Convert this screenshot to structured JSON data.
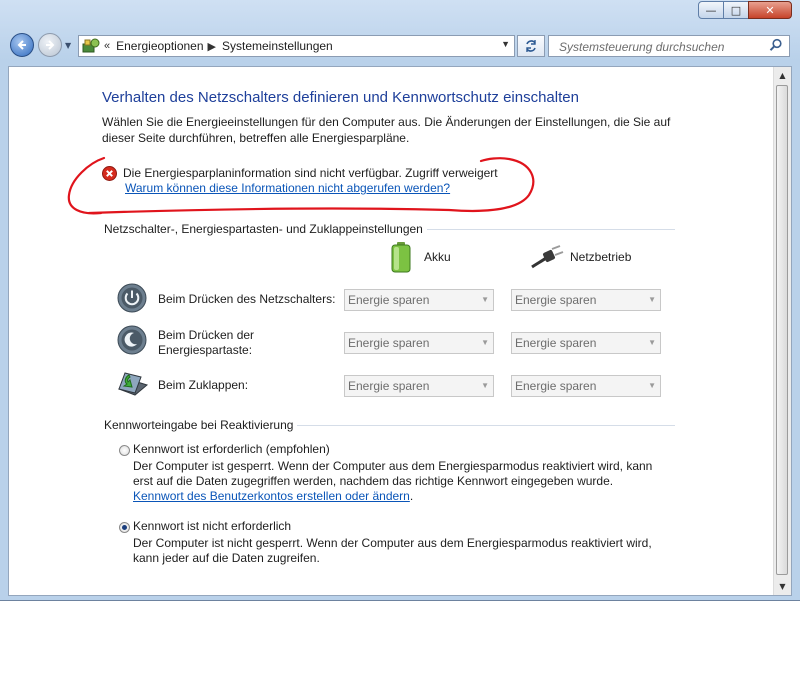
{
  "window": {
    "titlebar_blur_text": "",
    "buttons": {
      "minimize": "—",
      "maximize": "□",
      "close": "✕"
    }
  },
  "nav": {
    "back_icon": "arrow-left-icon",
    "forward_icon": "arrow-right-icon",
    "breadcrumb_prefix": "«",
    "crumbs": [
      "Energieoptionen",
      "Systemeinstellungen"
    ],
    "search_placeholder": "Systemsteuerung durchsuchen"
  },
  "page": {
    "title": "Verhalten des Netzschalters definieren und Kennwortschutz einschalten",
    "description": "Wählen Sie die Energieeinstellungen für den Computer aus. Die Änderungen der Einstellungen, die Sie auf dieser Seite durchführen, betreffen alle Energiesparpläne.",
    "error_text": "Die Energiesparplaninformation sind nicht verfügbar. Zugriff verweigert",
    "error_link": "Warum können diese Informationen nicht abgerufen werden?"
  },
  "power_section": {
    "heading": "Netzschalter-, Energiespartasten- und Zuklappeinstellungen",
    "columns": {
      "battery": "Akku",
      "ac": "Netzbetrieb"
    },
    "rows": [
      {
        "label": "Beim Drücken des Netzschalters:",
        "battery": "Energie sparen",
        "ac": "Energie sparen"
      },
      {
        "label_line1": "Beim Drücken der",
        "label_line2": "Energiespartaste:",
        "battery": "Energie sparen",
        "ac": "Energie sparen"
      },
      {
        "label": "Beim Zuklappen:",
        "battery": "Energie sparen",
        "ac": "Energie sparen"
      }
    ]
  },
  "password_section": {
    "heading": "Kennworteingabe bei Reaktivierung",
    "options": [
      {
        "title": "Kennwort ist erforderlich (empfohlen)",
        "line1": "Der Computer ist gesperrt. Wenn der Computer aus dem Energiesparmodus reaktiviert wird, kann",
        "line2": "erst auf die Daten zugegriffen werden, nachdem das richtige Kennwort eingegeben wurde.",
        "link": "Kennwort des Benutzerkontos erstellen oder ändern",
        "link_suffix": ".",
        "selected": false
      },
      {
        "title": "Kennwort ist nicht erforderlich",
        "line1": "Der Computer ist nicht gesperrt. Wenn der Computer aus dem Energiesparmodus reaktiviert wird,",
        "line2": "kann jeder auf die Daten zugreifen.",
        "selected": true
      }
    ]
  },
  "colors": {
    "title_blue": "#1e3f9a",
    "link_blue": "#0a55b8",
    "annotation_red": "#e0141c"
  }
}
